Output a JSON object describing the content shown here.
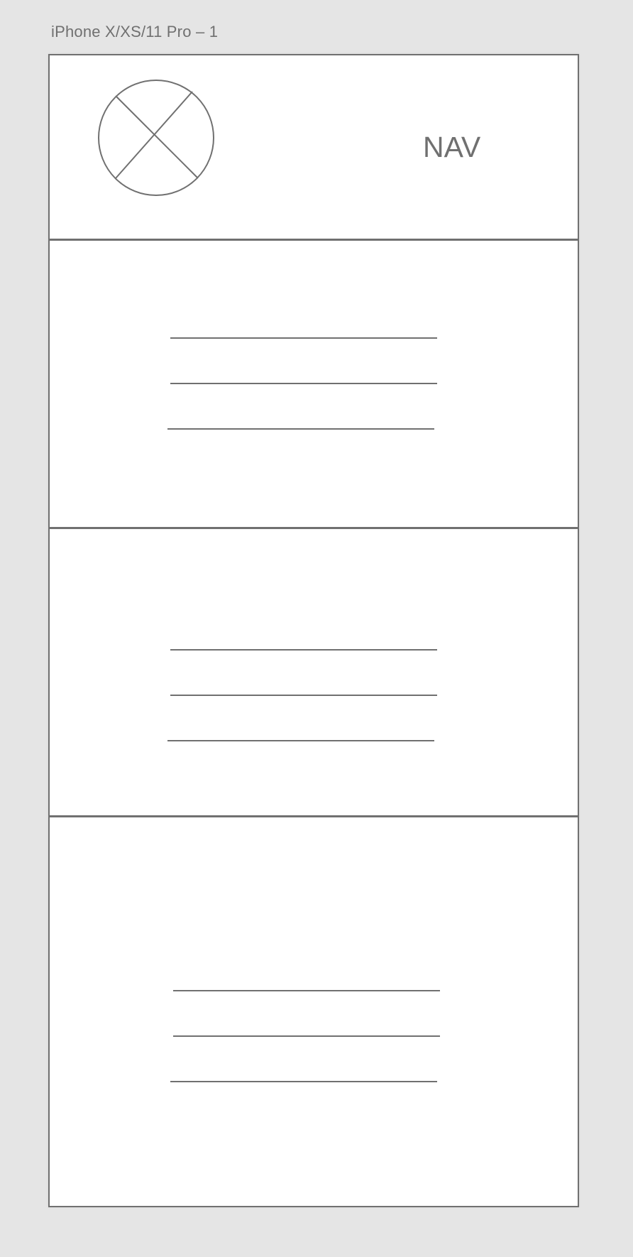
{
  "artboard": {
    "title": "iPhone X/XS/11 Pro – 1"
  },
  "header": {
    "logo_icon": "image-placeholder-icon",
    "nav_label": "NAV"
  },
  "sections": [
    {
      "name": "content-section-1",
      "lines": 3
    },
    {
      "name": "content-section-2",
      "lines": 3
    },
    {
      "name": "content-section-3",
      "lines": 3
    }
  ],
  "colors": {
    "background": "#e5e5e5",
    "artboard": "#ffffff",
    "stroke": "#707070"
  }
}
